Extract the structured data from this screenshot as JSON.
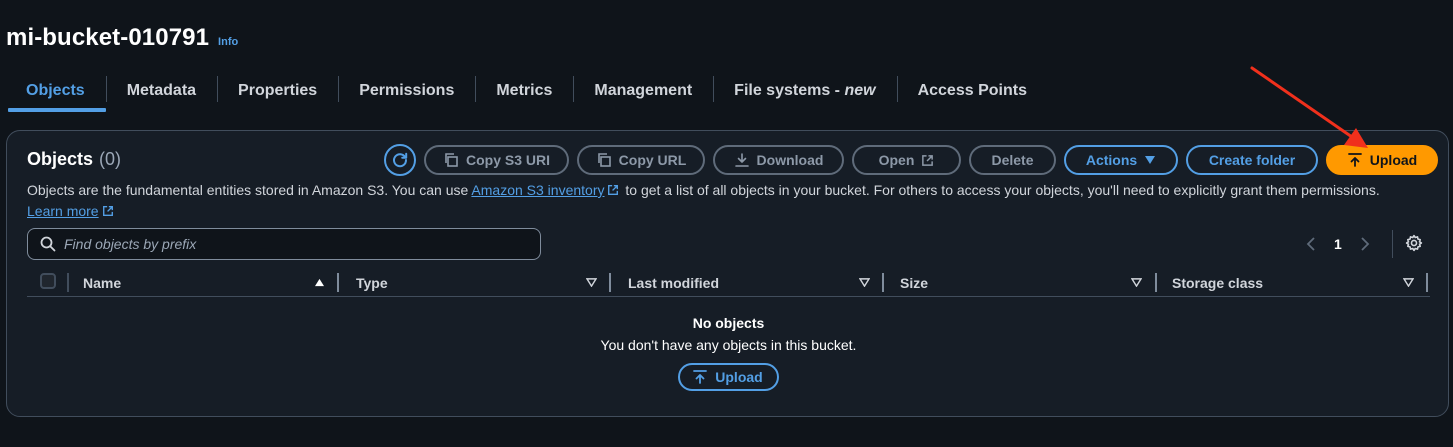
{
  "page": {
    "title": "mi-bucket-010791",
    "info_link": "Info"
  },
  "tabs": [
    {
      "label": "Objects",
      "active": true
    },
    {
      "label": "Metadata"
    },
    {
      "label": "Properties"
    },
    {
      "label": "Permissions"
    },
    {
      "label": "Metrics"
    },
    {
      "label": "Management"
    },
    {
      "label_prefix": "File systems - ",
      "label_suffix": "new"
    },
    {
      "label": "Access Points"
    }
  ],
  "objects": {
    "heading": "Objects",
    "count": "(0)",
    "toolbar": {
      "refresh_icon": "refresh-icon",
      "copy_s3_uri": "Copy S3 URI",
      "copy_url": "Copy URL",
      "download": "Download",
      "open": "Open",
      "delete": "Delete",
      "actions": "Actions",
      "create_folder": "Create folder",
      "upload": "Upload"
    },
    "description": {
      "part1": "Objects are the fundamental entities stored in Amazon S3. You can use ",
      "inventory_link": "Amazon S3 inventory",
      "part2": " to get a list of all objects in your bucket. For others to access your objects, you'll need to explicitly grant them permissions.",
      "learn_more": "Learn more"
    },
    "search": {
      "placeholder": "Find objects by prefix",
      "value": ""
    },
    "pagination": {
      "current_page": "1"
    },
    "table": {
      "columns": [
        "Name",
        "Type",
        "Last modified",
        "Size",
        "Storage class"
      ]
    },
    "empty_state": {
      "title": "No objects",
      "subtitle": "You don't have any objects in this bucket.",
      "upload_label": "Upload"
    }
  },
  "colors": {
    "accent": "#539fe5",
    "primary": "#ff9900",
    "background": "#0f141a",
    "container": "#161d26",
    "annotation_arrow": "#f0301c"
  }
}
